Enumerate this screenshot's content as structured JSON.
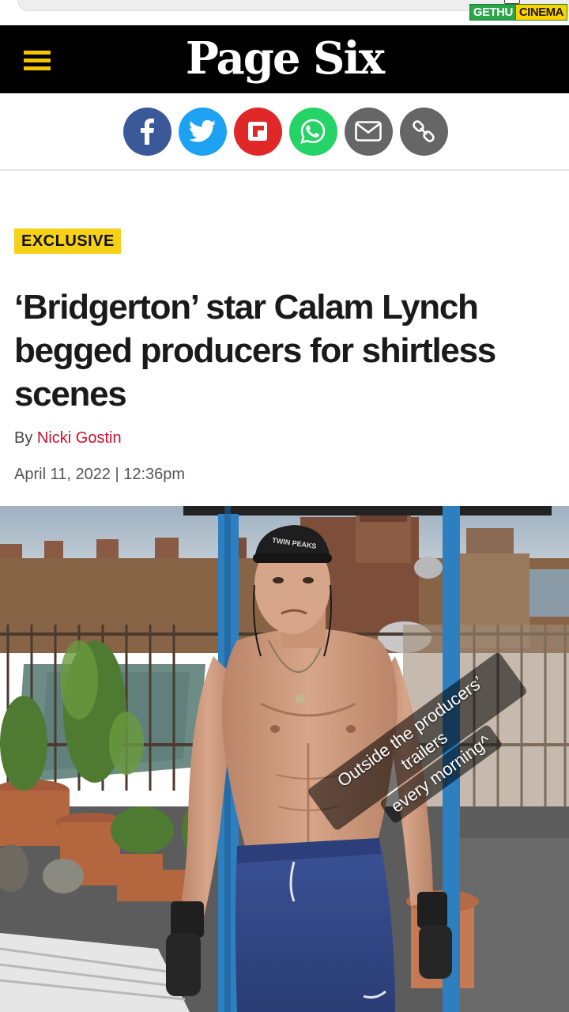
{
  "watermark": {
    "part1": "GETHU",
    "part2": "CINEMA"
  },
  "header": {
    "logo": "Page Six",
    "menu_icon": "hamburger-menu-icon",
    "background": "#000000",
    "accent": "#f2c500"
  },
  "share": [
    {
      "name": "facebook",
      "icon": "facebook-icon",
      "color": "#3b5998"
    },
    {
      "name": "twitter",
      "icon": "twitter-icon",
      "color": "#1da1f2"
    },
    {
      "name": "flipboard",
      "icon": "flipboard-icon",
      "color": "#e12828"
    },
    {
      "name": "whatsapp",
      "icon": "whatsapp-icon",
      "color": "#25d366"
    },
    {
      "name": "email",
      "icon": "email-icon",
      "color": "#666666"
    },
    {
      "name": "copy-link",
      "icon": "link-icon",
      "color": "#666666"
    }
  ],
  "article": {
    "tag": "EXCLUSIVE",
    "tag_color": "#f7d117",
    "headline": "‘Bridgerton’ star Calam Lynch begged producers for shirtless scenes",
    "byline_prefix": "By",
    "author": "Nicki Gostin",
    "author_color": "#c8102e",
    "date": "April 11, 2022 | 12:36pm"
  },
  "photo": {
    "cap_text": "TWIN PEAKS",
    "caption_line1": "Outside the producers’ trailers",
    "caption_line2": "every morning^"
  }
}
